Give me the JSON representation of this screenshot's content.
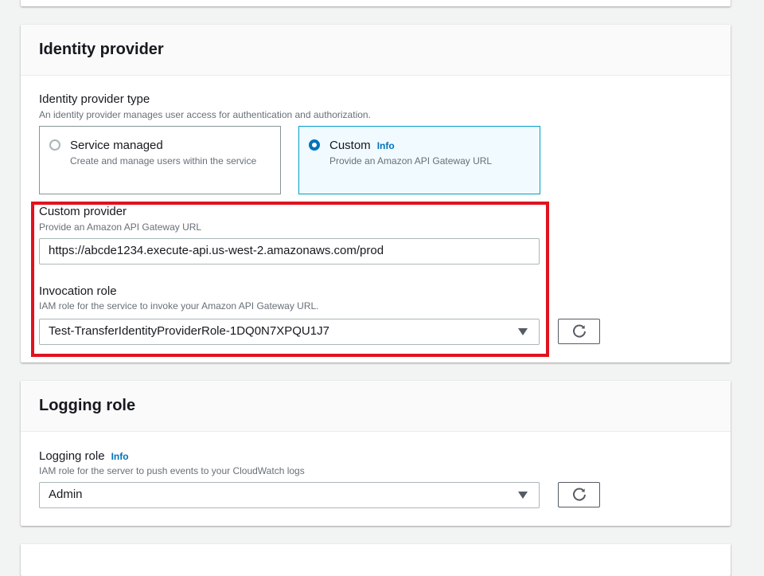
{
  "identity_provider": {
    "title": "Identity provider",
    "type_label": "Identity provider type",
    "type_description": "An identity provider manages user access for authentication and authorization.",
    "options": [
      {
        "label": "Service managed",
        "description": "Create and manage users within the service",
        "selected": false
      },
      {
        "label": "Custom",
        "info": "Info",
        "description": "Provide an Amazon API Gateway URL",
        "selected": true
      }
    ],
    "custom_provider": {
      "label": "Custom provider",
      "description": "Provide an Amazon API Gateway URL",
      "value": "https://abcde1234.execute-api.us-west-2.amazonaws.com/prod"
    },
    "invocation_role": {
      "label": "Invocation role",
      "description": "IAM role for the service to invoke your Amazon API Gateway URL.",
      "value": "Test-TransferIdentityProviderRole-1DQ0N7XPQU1J7"
    }
  },
  "logging_role": {
    "title": "Logging role",
    "label": "Logging role",
    "info": "Info",
    "description": "IAM role for the server to push events to your CloudWatch logs",
    "value": "Admin"
  },
  "icons": {
    "refresh": "refresh-icon",
    "dropdown": "caret-down-icon",
    "radio_selected": "radio-selected-icon",
    "radio_unselected": "radio-unselected-icon"
  },
  "colors": {
    "accent": "#0073bb",
    "selected_tile_border": "#00a1c9",
    "selected_tile_bg": "#f1faff",
    "highlight_box": "#e0121e"
  }
}
